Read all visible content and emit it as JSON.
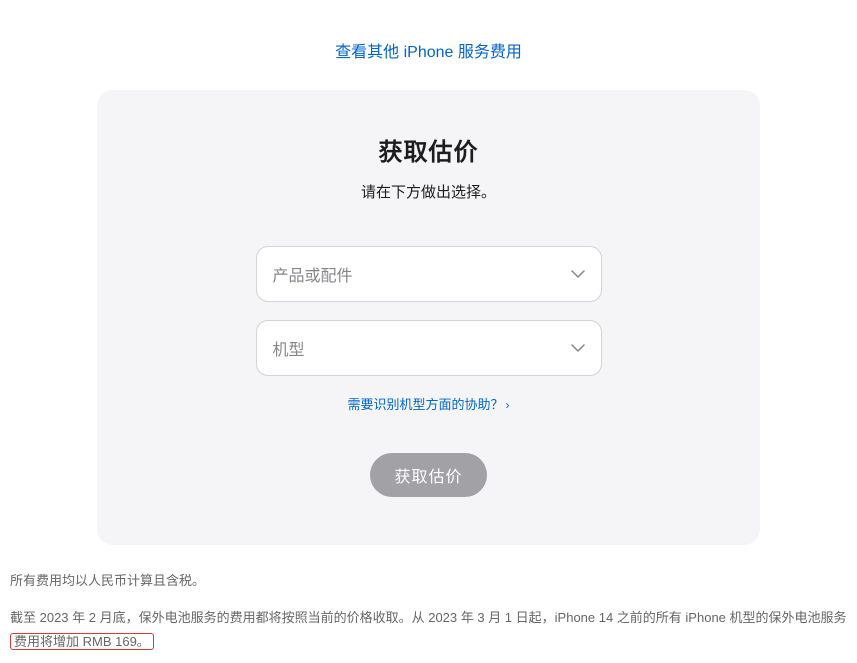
{
  "topLink": {
    "text": "查看其他 iPhone 服务费用"
  },
  "card": {
    "title": "获取估价",
    "subtitle": "请在下方做出选择。",
    "selectProduct": {
      "placeholder": "产品或配件"
    },
    "selectModel": {
      "placeholder": "机型"
    },
    "helpLink": {
      "text": "需要识别机型方面的协助？",
      "arrow": "›"
    },
    "submitButton": {
      "label": "获取估价"
    }
  },
  "disclaimer": {
    "line1": "所有费用均以人民币计算且含税。",
    "line2_part1": "截至 2023 年 2 月底，保外电池服务的费用都将按照当前的价格收取。从 2023 年 3 月 1 日起，iPhone 14 之前的所有 iPhone 机型的保外电池服务",
    "line2_highlight": "费用将增加 RMB 169。"
  }
}
